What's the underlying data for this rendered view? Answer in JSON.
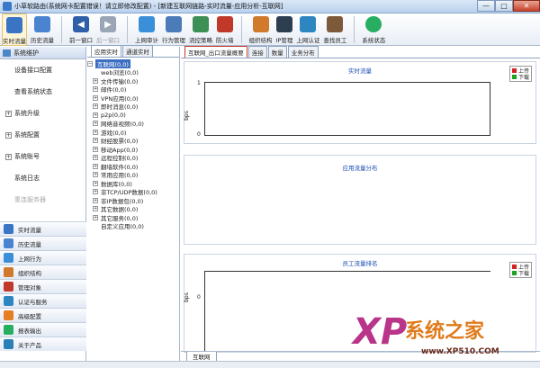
{
  "window": {
    "title": "小草软路由(系统网卡配置错误！请立即修改配置) - [新建互联网链路-实时流量-应用分析-互联网]",
    "minimize": "—",
    "maximize": "□",
    "close": "✕"
  },
  "toolbar": {
    "items": [
      {
        "label": "实时流量",
        "icon": "monitor-icon",
        "color": "#3a74c4"
      },
      {
        "label": "历史流量",
        "icon": "history-icon",
        "color": "#4a84d0"
      },
      {
        "label": "前一窗口",
        "icon": "arrow-left-icon",
        "color": "#2f5fa8"
      },
      {
        "label": "后一窗口",
        "icon": "arrow-right-icon",
        "color": "#9aa6b6"
      },
      {
        "label": "上网审计",
        "icon": "audit-icon",
        "color": "#3b8fd9"
      },
      {
        "label": "行为管理",
        "icon": "behavior-icon",
        "color": "#4b7bb8"
      },
      {
        "label": "流控策略",
        "icon": "flow-control-icon",
        "color": "#3c8f55"
      },
      {
        "label": "防火墙",
        "icon": "firewall-icon",
        "color": "#c0392b"
      },
      {
        "label": "组织结构",
        "icon": "org-icon",
        "color": "#d17a2b"
      },
      {
        "label": "IP管理",
        "icon": "ip-icon",
        "color": "#2c3e50"
      },
      {
        "label": "上网认证",
        "icon": "auth-icon",
        "color": "#2e86c1"
      },
      {
        "label": "查找员工",
        "icon": "search-user-icon",
        "color": "#7d5a3a"
      },
      {
        "label": "系统状态",
        "icon": "status-icon",
        "color": "#27ae60"
      }
    ]
  },
  "left_panel": {
    "header": "系统维护",
    "menu": [
      {
        "label": "设备接口配置",
        "expandable": false,
        "disabled": false
      },
      {
        "label": "查看系统状态",
        "expandable": false,
        "disabled": false
      },
      {
        "label": "系统升级",
        "expandable": true,
        "disabled": false
      },
      {
        "label": "系统配置",
        "expandable": true,
        "disabled": false
      },
      {
        "label": "系统账号",
        "expandable": true,
        "disabled": false
      },
      {
        "label": "系统日志",
        "expandable": false,
        "disabled": false
      },
      {
        "label": "重连服务器",
        "expandable": false,
        "disabled": true
      }
    ],
    "outlook": [
      {
        "label": "实时流量",
        "icon": "monitor-icon",
        "color": "#3a74c4"
      },
      {
        "label": "历史流量",
        "icon": "history-icon",
        "color": "#4a84d0"
      },
      {
        "label": "上网行为",
        "icon": "behavior-icon",
        "color": "#3b8fd9"
      },
      {
        "label": "组织结构",
        "icon": "org-icon",
        "color": "#d17a2b"
      },
      {
        "label": "管理对象",
        "icon": "object-icon",
        "color": "#c0392b"
      },
      {
        "label": "认证与服务",
        "icon": "auth-icon",
        "color": "#2e86c1"
      },
      {
        "label": "高级配置",
        "icon": "advanced-icon",
        "color": "#e67e22"
      },
      {
        "label": "报表输出",
        "icon": "report-icon",
        "color": "#27ae60"
      },
      {
        "label": "关于产品",
        "icon": "about-icon",
        "color": "#2980b9"
      }
    ]
  },
  "tree_panel": {
    "tabs": [
      "应用实时",
      "通道实时"
    ],
    "root": "互联网(0,0)",
    "nodes": [
      {
        "label": "web浏览(0,0)",
        "expandable": false
      },
      {
        "label": "文件传输(0,0)",
        "expandable": true
      },
      {
        "label": "邮件(0,0)",
        "expandable": true
      },
      {
        "label": "VPN应用(0,0)",
        "expandable": true
      },
      {
        "label": "即时消息(0,0)",
        "expandable": true
      },
      {
        "label": "p2p(0,0)",
        "expandable": true
      },
      {
        "label": "网络音视频(0,0)",
        "expandable": true
      },
      {
        "label": "游戏(0,0)",
        "expandable": true
      },
      {
        "label": "财经股票(0,0)",
        "expandable": true
      },
      {
        "label": "移动App(0,0)",
        "expandable": true
      },
      {
        "label": "远程控制(0,0)",
        "expandable": true
      },
      {
        "label": "翻墙软件(0,0)",
        "expandable": true
      },
      {
        "label": "常用应用(0,0)",
        "expandable": true
      },
      {
        "label": "数据库(0,0)",
        "expandable": true
      },
      {
        "label": "非TCP/UDP数据(0,0)",
        "expandable": true
      },
      {
        "label": "非IP数据包(0,0)",
        "expandable": true
      },
      {
        "label": "其它数据(0,0)",
        "expandable": true
      },
      {
        "label": "其它服务(0,0)",
        "expandable": true
      },
      {
        "label": "自定义应用(0,0)",
        "expandable": false
      }
    ]
  },
  "main": {
    "tabs": [
      "互联网_出口流量概要",
      "连接",
      "数量",
      "业务分布"
    ],
    "bottom_tab": "互联网",
    "legend": {
      "upload": "上传",
      "download": "下载",
      "upload_color": "#d62020",
      "download_color": "#1fa21f"
    }
  },
  "chart_data": [
    {
      "type": "line",
      "title": "实时流量",
      "ylabel": "bps",
      "y_ticks": [
        "1",
        "0"
      ],
      "ylim": [
        0,
        1
      ],
      "series": [
        {
          "name": "上传",
          "values": []
        },
        {
          "name": "下载",
          "values": []
        }
      ],
      "legend": "top-right"
    },
    {
      "type": "pie",
      "title": "应用流量分布",
      "values": []
    },
    {
      "type": "bar",
      "title": "员工流量排名",
      "ylabel": "bps",
      "y_ticks": [
        "0"
      ],
      "series": [
        {
          "name": "上传",
          "values": []
        },
        {
          "name": "下载",
          "values": []
        }
      ],
      "legend": "top-right"
    }
  ],
  "watermark": {
    "logo": "XP",
    "name": "系统之家",
    "url": "www.XP510.COM"
  }
}
